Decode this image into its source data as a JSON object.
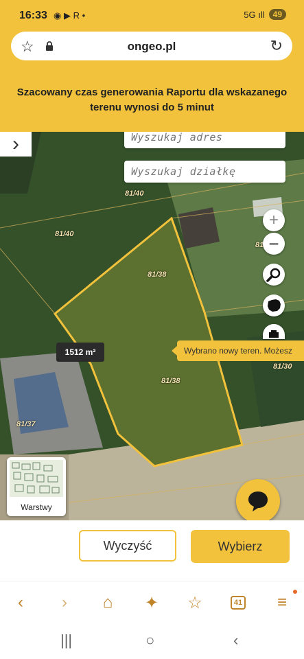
{
  "status": {
    "time": "16:33",
    "app_icons": "◉ ▶ R •",
    "signal": "5G ıll",
    "battery": "49"
  },
  "browser": {
    "domain": "ongeo.pl"
  },
  "banner": {
    "text": "Szacowany czas generowania Raportu dla wskazanego terenu wynosi do 5 minut"
  },
  "map": {
    "search_address_placeholder": "Wyszukaj adres",
    "search_parcel_placeholder": "Wyszukaj działkę",
    "labels": [
      "81/40",
      "81/40",
      "81/38",
      "81/38",
      "81/37",
      "81/30",
      "81"
    ],
    "area": "1512 m²",
    "tooltip": "Wybrano nowy teren. Możesz",
    "layers_label": "Warstwy",
    "zoom_in": "+",
    "zoom_out": "−"
  },
  "actions": {
    "clear": "Wyczyść",
    "select": "Wybierz"
  },
  "browser_nav": {
    "tabs_count": "41"
  },
  "colors": {
    "accent": "#f2c23c",
    "parcel_outline": "#f2c23c"
  }
}
